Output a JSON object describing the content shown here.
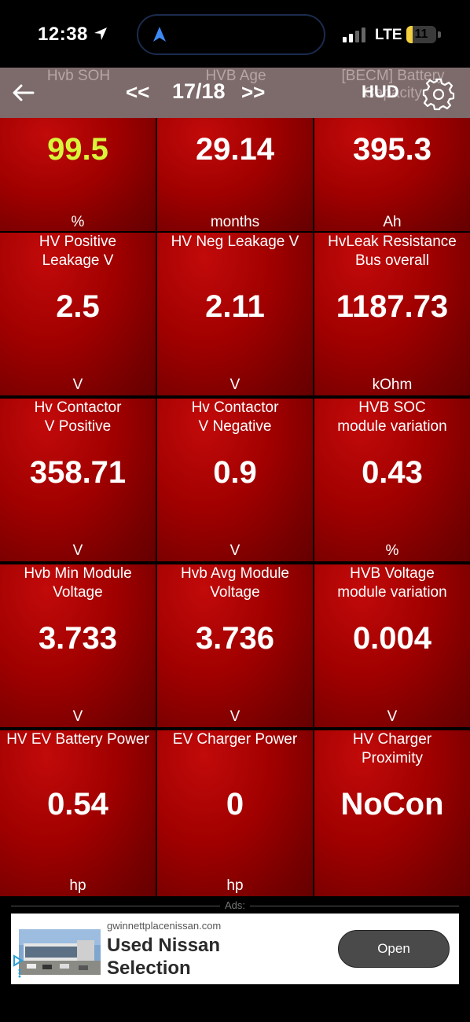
{
  "status_bar": {
    "time": "12:38",
    "network": "LTE",
    "battery_level": "11",
    "battery_fraction": 0.11
  },
  "header": {
    "back_icon": "arrow-left-icon",
    "prev_label": "<<",
    "page_indicator": "17/18",
    "next_label": ">>",
    "hud_label": "HUD",
    "settings_icon": "gear-icon",
    "background_labels": [
      "Hvb SOH",
      "HVB Age",
      "[BECM] Battery\nCapacity"
    ]
  },
  "gauges": [
    {
      "value": "99.5",
      "unit": "%",
      "value_color": "#d8f53a"
    },
    {
      "value": "29.14",
      "unit": "months"
    },
    {
      "value": "395.3",
      "unit": "Ah"
    },
    {
      "label": "HV Positive\nLeakage V",
      "value": "2.5",
      "unit": "V"
    },
    {
      "label": "HV Neg Leakage V",
      "value": "2.11",
      "unit": "V"
    },
    {
      "label": "HvLeak Resistance\nBus overall",
      "value": "1187.73",
      "unit": "kOhm"
    },
    {
      "label": "Hv Contactor\nV Positive",
      "value": "358.71",
      "unit": "V"
    },
    {
      "label": "Hv Contactor\nV Negative",
      "value": "0.9",
      "unit": "V"
    },
    {
      "label": "HVB SOC\nmodule variation",
      "value": "0.43",
      "unit": "%"
    },
    {
      "label": "Hvb Min Module\nVoltage",
      "value": "3.733",
      "unit": "V"
    },
    {
      "label": "Hvb Avg Module\nVoltage",
      "value": "3.736",
      "unit": "V"
    },
    {
      "label": "HVB Voltage\nmodule variation",
      "value": "0.004",
      "unit": "V"
    },
    {
      "label": "HV EV Battery Power",
      "value": "0.54",
      "unit": "hp"
    },
    {
      "label": "EV Charger Power",
      "value": "0",
      "unit": "hp"
    },
    {
      "label": "HV Charger\nProximity",
      "value": "NoCon",
      "unit": ""
    }
  ],
  "ad": {
    "section_label": "Ads:",
    "domain": "gwinnettplacenissan.com",
    "title": "Used Nissan\nSelection",
    "cta": "Open"
  },
  "colors": {
    "cell_red": "#a00000",
    "header_overlay": "#7d6a6a",
    "highlight_value": "#d8f53a"
  }
}
